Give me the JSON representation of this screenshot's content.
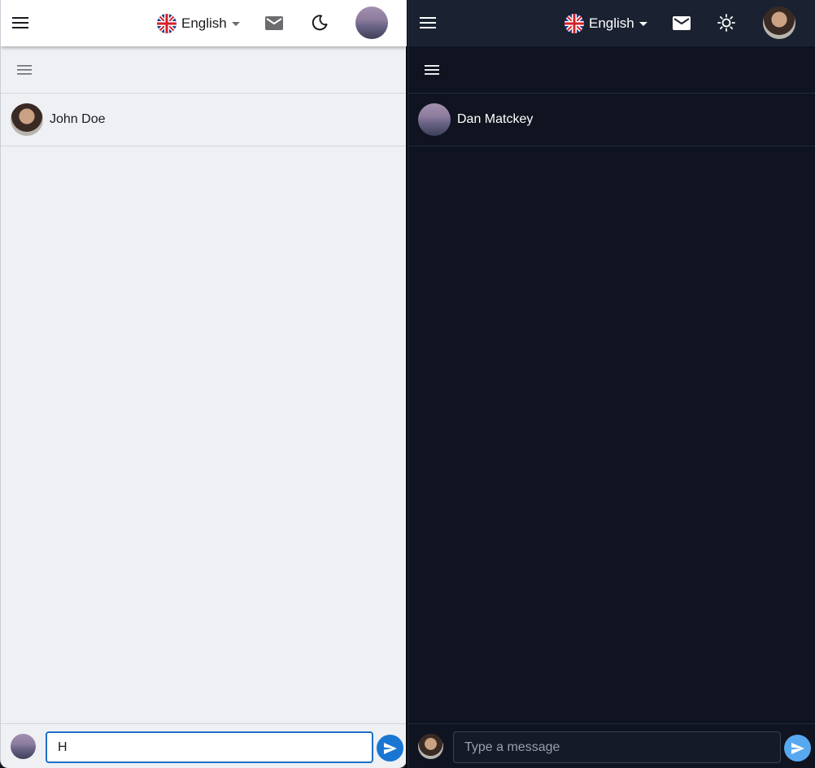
{
  "light_pane": {
    "header": {
      "menu_icon": "hamburger-menu-icon",
      "language_label": "English",
      "flag_icon": "uk-flag-icon",
      "mail_icon": "mail-icon",
      "theme_icon": "moon-icon"
    },
    "sidebar_toggle_icon": "hamburger-menu-icon",
    "contact": {
      "name": "John Doe"
    },
    "composer": {
      "input_value": "H",
      "send_icon": "send-icon"
    }
  },
  "dark_pane": {
    "header": {
      "menu_icon": "hamburger-menu-icon",
      "language_label": "English",
      "flag_icon": "uk-flag-icon",
      "mail_icon": "mail-icon",
      "theme_icon": "sun-icon"
    },
    "sidebar_toggle_icon": "hamburger-menu-icon",
    "contact": {
      "name": "Dan Matckey"
    },
    "composer": {
      "input_placeholder": "Type a message",
      "send_icon": "send-icon"
    }
  },
  "colors": {
    "light_bg": "#eff0f4",
    "dark_bg": "#0f1420",
    "dark_header": "#1a2130",
    "accent_light": "#1976d2",
    "accent_dark": "#58a8f0"
  }
}
